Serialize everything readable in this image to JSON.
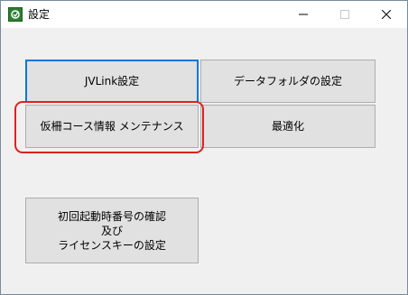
{
  "window": {
    "title": "設定",
    "icon": "app-icon"
  },
  "titlebar_controls": {
    "minimize_icon": "minimize-icon",
    "maximize_icon": "maximize-icon",
    "close_icon": "close-icon"
  },
  "buttons": {
    "jvlink_settings": "JVLink設定",
    "data_folder_settings": "データフォルダの設定",
    "course_maintenance": "仮柵コース情報 メンテナンス",
    "optimize": "最適化",
    "initial_setup": {
      "line1": "初回起動時番号の確認",
      "line2": "及び",
      "line3": "ライセンスキーの設定"
    }
  },
  "colors": {
    "highlight": "#e02020",
    "default_button_border": "#0078d7",
    "button_face": "#e1e1e1",
    "window_bg": "#f0f0f0"
  }
}
